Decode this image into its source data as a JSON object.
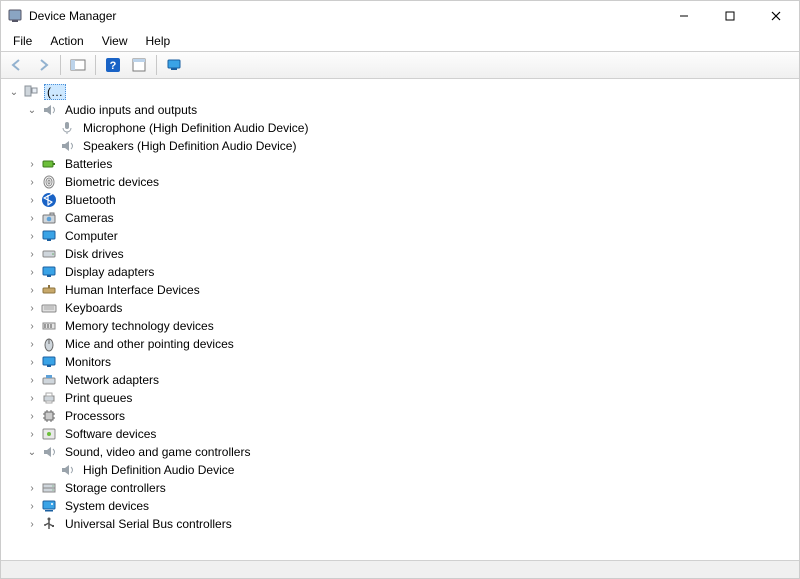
{
  "window": {
    "title": "Device Manager"
  },
  "menu": {
    "file": "File",
    "action": "Action",
    "view": "View",
    "help": "Help"
  },
  "toolbar": {
    "back": "Back",
    "forward": "Forward",
    "show_hide_tree": "Show/Hide Console Tree",
    "help": "Help",
    "properties": "Properties",
    "scan": "Scan for hardware changes"
  },
  "tree": {
    "root": {
      "label": "(…",
      "expanded": true,
      "selected": true
    },
    "audio_io": {
      "label": "Audio inputs and outputs",
      "expanded": true,
      "children": {
        "mic": "Microphone (High Definition Audio Device)",
        "spk": "Speakers (High Definition Audio Device)"
      }
    },
    "batteries": {
      "label": "Batteries"
    },
    "biometric": {
      "label": "Biometric devices"
    },
    "bluetooth": {
      "label": "Bluetooth"
    },
    "cameras": {
      "label": "Cameras"
    },
    "computer": {
      "label": "Computer"
    },
    "disk_drives": {
      "label": "Disk drives"
    },
    "display_adapters": {
      "label": "Display adapters"
    },
    "hid": {
      "label": "Human Interface Devices"
    },
    "keyboards": {
      "label": "Keyboards"
    },
    "memtech": {
      "label": "Memory technology devices"
    },
    "mice": {
      "label": "Mice and other pointing devices"
    },
    "monitors": {
      "label": "Monitors"
    },
    "network": {
      "label": "Network adapters"
    },
    "print_queues": {
      "label": "Print queues"
    },
    "processors": {
      "label": "Processors"
    },
    "software_devices": {
      "label": "Software devices"
    },
    "svgc": {
      "label": "Sound, video and game controllers",
      "expanded": true,
      "children": {
        "hda": "High Definition Audio Device"
      }
    },
    "storage_controllers": {
      "label": "Storage controllers"
    },
    "system_devices": {
      "label": "System devices"
    },
    "usb": {
      "label": "Universal Serial Bus controllers"
    }
  }
}
